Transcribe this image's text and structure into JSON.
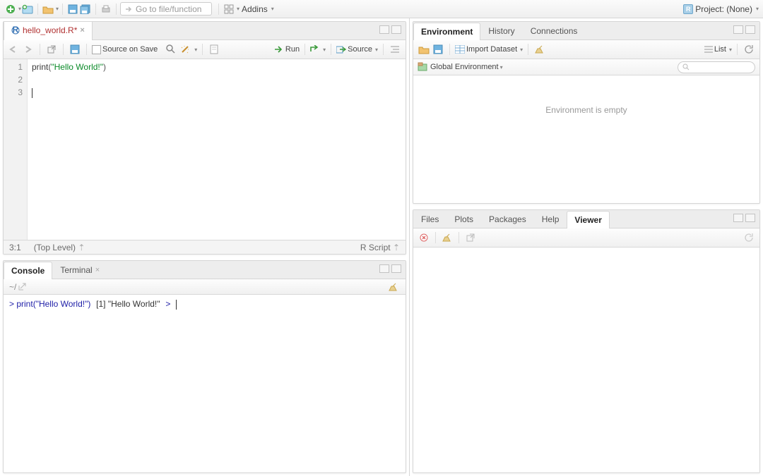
{
  "topbar": {
    "search_placeholder": "Go to file/function",
    "addins": "Addins",
    "project_label": "Project: (None)"
  },
  "source_pane": {
    "tab": {
      "filename": "hello_world.R*"
    },
    "toolbar": {
      "source_on_save": "Source on Save",
      "run": "Run",
      "source": "Source"
    },
    "code": {
      "lines": [
        "1",
        "2",
        "3"
      ],
      "line1_fn": "print",
      "line1_open": "(",
      "line1_str": "\"Hello World!\"",
      "line1_close": ")"
    },
    "status": {
      "pos": "3:1",
      "scope": "(Top Level)",
      "lang": "R Script"
    }
  },
  "console_pane": {
    "tabs": {
      "console": "Console",
      "terminal": "Terminal"
    },
    "path": "~/",
    "lines": {
      "prompt1": ">",
      "cmd1": " print(\"Hello World!\")",
      "out1": "[1] \"Hello World!\"",
      "prompt2": ">"
    }
  },
  "env_pane": {
    "tabs": {
      "environment": "Environment",
      "history": "History",
      "connections": "Connections"
    },
    "toolbar": {
      "import": "Import Dataset",
      "list": "List"
    },
    "subbar": {
      "scope": "Global Environment"
    },
    "empty_msg": "Environment is empty"
  },
  "viewer_pane": {
    "tabs": {
      "files": "Files",
      "plots": "Plots",
      "packages": "Packages",
      "help": "Help",
      "viewer": "Viewer"
    }
  }
}
